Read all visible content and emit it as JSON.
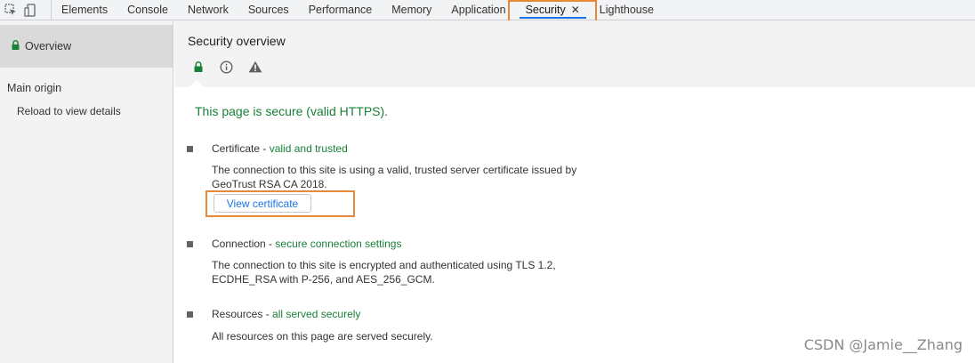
{
  "tabs": [
    {
      "label": "Elements"
    },
    {
      "label": "Console"
    },
    {
      "label": "Network"
    },
    {
      "label": "Sources"
    },
    {
      "label": "Performance"
    },
    {
      "label": "Memory"
    },
    {
      "label": "Application"
    },
    {
      "label": "Security",
      "active": true,
      "close": "✕"
    },
    {
      "label": "Lighthouse"
    }
  ],
  "sidebar": {
    "overview": "Overview",
    "main_origin": "Main origin",
    "reload": "Reload to view details"
  },
  "main": {
    "title": "Security overview",
    "summary": "This page is secure (valid HTTPS).",
    "certificate": {
      "label": "Certificate",
      "sep": " - ",
      "status": "valid and trusted",
      "desc": "The connection to this site is using a valid, trusted server certificate issued by GeoTrust RSA CA 2018.",
      "button": "View certificate"
    },
    "connection": {
      "label": "Connection",
      "sep": " - ",
      "status": "secure connection settings",
      "desc": "The connection to this site is encrypted and authenticated using TLS 1.2, ECDHE_RSA with P-256, and AES_256_GCM."
    },
    "resources": {
      "label": "Resources",
      "sep": " - ",
      "status": "all served securely",
      "desc": "All resources on this page are served securely."
    }
  },
  "watermark": "CSDN @Jamie__Zhang",
  "colors": {
    "secure_green": "#188038",
    "highlight_orange": "#e8893a",
    "link_blue": "#1a73e8"
  },
  "icons": [
    "inspect-icon",
    "device-toggle-icon",
    "lock-icon",
    "info-icon",
    "warning-icon"
  ]
}
